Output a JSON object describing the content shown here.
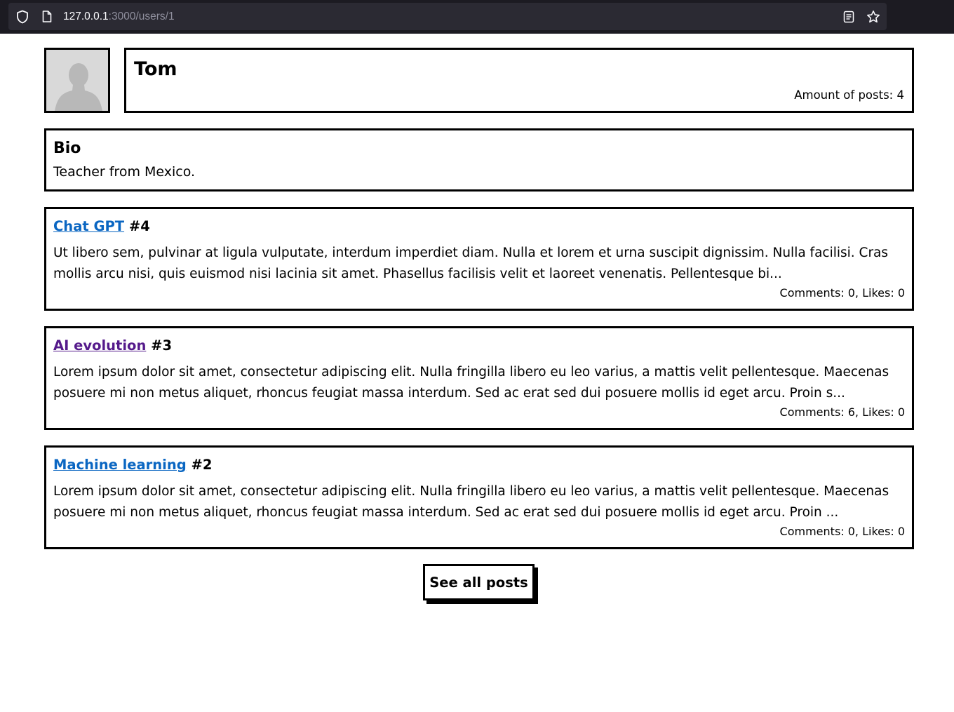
{
  "browser": {
    "url_host": "127.0.0.1",
    "url_path": ":3000/users/1"
  },
  "user": {
    "name": "Tom",
    "post_count_text": "Amount of posts: 4",
    "avatar_icon": "user-silhouette-icon"
  },
  "bio": {
    "heading": "Bio",
    "text": "Teacher from Mexico."
  },
  "posts": [
    {
      "title": "Chat GPT",
      "number": "#4",
      "visited": false,
      "body": "Ut libero sem, pulvinar at ligula vulputate, interdum imperdiet diam. Nulla et lorem et urna suscipit dignissim. Nulla facilisi. Cras mollis arcu nisi, quis euismod nisi lacinia sit amet. Phasellus facilisis velit et laoreet venenatis. Pellentesque bi...",
      "stats": "Comments: 0, Likes: 0"
    },
    {
      "title": "AI evolution",
      "number": "#3",
      "visited": true,
      "body": "Lorem ipsum dolor sit amet, consectetur adipiscing elit. Nulla fringilla libero eu leo varius, a mattis velit pellentesque. Maecenas posuere mi non metus aliquet, rhoncus feugiat massa interdum. Sed ac erat sed dui posuere mollis id eget arcu. Proin s...",
      "stats": "Comments: 6, Likes: 0"
    },
    {
      "title": "Machine learning",
      "number": "#2",
      "visited": false,
      "body": "Lorem ipsum dolor sit amet, consectetur adipiscing elit. Nulla fringilla libero eu leo varius, a mattis velit pellentesque. Maecenas posuere mi non metus aliquet, rhoncus feugiat massa interdum. Sed ac erat sed dui posuere mollis id eget arcu. Proin ...",
      "stats": "Comments: 0, Likes: 0"
    }
  ],
  "actions": {
    "see_all_label": "See all posts"
  },
  "colors": {
    "link": "#0a66c2",
    "visited_link": "#551a8b",
    "border": "#000000",
    "chrome_bg": "#1c1b22"
  }
}
